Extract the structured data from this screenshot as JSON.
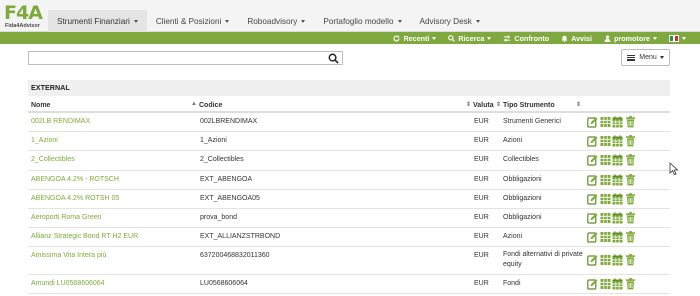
{
  "brand": {
    "logo_text": "F4A",
    "subtitle": "Fida4Advisor",
    "color": "#7eaa3a"
  },
  "nav": {
    "items": [
      {
        "label": "Strumenti Finanziari",
        "active": true
      },
      {
        "label": "Clienti & Posizioni",
        "active": false
      },
      {
        "label": "Roboadvisory",
        "active": false
      },
      {
        "label": "Portafoglio modello",
        "active": false
      },
      {
        "label": "Advisory Desk",
        "active": false
      }
    ]
  },
  "subbar": {
    "recenti": "Recenti",
    "ricerca": "Ricerca",
    "confronto": "Confronto",
    "avvisi": "Avvisi",
    "user": "promotore",
    "color": "#7fa93f"
  },
  "search": {
    "value": "",
    "placeholder": ""
  },
  "menu_button": "Menu",
  "section": "EXTERNAL",
  "columns": {
    "name": "Nome",
    "code": "Codice",
    "currency": "Valuta",
    "type": "Tipo Strumento"
  },
  "rows": [
    {
      "name": "002LB RENDIMAX",
      "code": "002LBRENDIMAX",
      "currency": "EUR",
      "type": "Strumenti Generici",
      "type2": ""
    },
    {
      "name": "1_Azioni",
      "code": "1_Azioni",
      "currency": "EUR",
      "type": "Azioni",
      "type2": ""
    },
    {
      "name": "2_Collectibles",
      "code": "2_Collectibles",
      "currency": "EUR",
      "type": "Collectibles",
      "type2": ""
    },
    {
      "name": "ABENGOA 4.2% - ROTSCH",
      "code": "EXT_ABENGOA",
      "currency": "EUR",
      "type": "Obbligazioni",
      "type2": ""
    },
    {
      "name": "ABENGOA 4.2% ROTSH 05",
      "code": "EXT_ABENGOA05",
      "currency": "EUR",
      "type": "Obbligazioni",
      "type2": ""
    },
    {
      "name": "Aeroporti Roma Green",
      "code": "prova_bond",
      "currency": "EUR",
      "type": "Obbligazioni",
      "type2": ""
    },
    {
      "name": "Allianz Strategic Bond RT H2 EUR",
      "code": "EXT_ALLIANZSTRBOND",
      "currency": "EUR",
      "type": "Azioni",
      "type2": ""
    },
    {
      "name": "Amissima Vita Intera più",
      "code": "637200468832011360",
      "currency": "EUR",
      "type": "Fondi alternativi di private",
      "type2": "equity"
    },
    {
      "name": "Amundi LU0568606064",
      "code": "LU0568606064",
      "currency": "EUR",
      "type": "Fondi",
      "type2": ""
    }
  ]
}
